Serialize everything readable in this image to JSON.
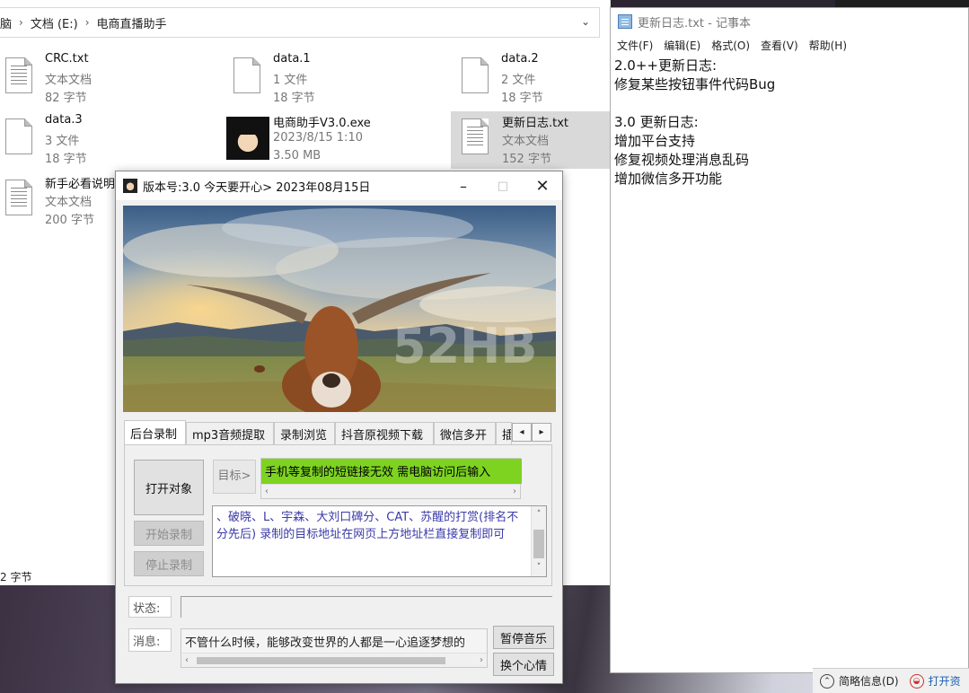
{
  "explorer": {
    "breadcrumb": [
      "脑",
      "文档 (E:)",
      "电商直播助手"
    ],
    "files": [
      {
        "name": "CRC.txt",
        "line2": "文本文档",
        "line3": "82 字节",
        "icon": "text-document-icon"
      },
      {
        "name": "data.1",
        "line2": "1 文件",
        "line3": "18 字节",
        "icon": "blank-document-icon"
      },
      {
        "name": "data.2",
        "line2": "2 文件",
        "line3": "18 字节",
        "icon": "blank-document-icon"
      },
      {
        "name": "data.3",
        "line2": "3 文件",
        "line3": "18 字节",
        "icon": "blank-document-icon"
      },
      {
        "name": "电商助手V3.0.exe",
        "line2": "2023/8/15 1:10",
        "line3": "3.50 MB",
        "icon": "exe-avatar-icon"
      },
      {
        "name": "更新日志.txt",
        "line2": "文本文档",
        "line3": "152 字节",
        "icon": "text-document-icon"
      },
      {
        "name": "新手必看说明",
        "line2": "文本文档",
        "line3": "200 字节",
        "icon": "text-document-icon"
      }
    ],
    "status_size": "2 字节"
  },
  "notepad": {
    "title": "更新日志.txt - 记事本",
    "menu": [
      "文件(F)",
      "编辑(E)",
      "格式(O)",
      "查看(V)",
      "帮助(H)"
    ],
    "lines": [
      "2.0++更新日志:",
      "修复某些按钮事件代码Bug",
      "",
      "3.0 更新日志:",
      "增加平台支持",
      "修复视频处理消息乱码",
      "增加微信多开功能"
    ]
  },
  "taskbar": {
    "brief_info": "简略信息(D)",
    "open_label": "打开资"
  },
  "app": {
    "title": "版本号:3.0 今天要开心> 2023年08月15日",
    "watermark": "52HB",
    "tabs": [
      "后台录制",
      "mp3音频提取",
      "录制浏览",
      "抖音原视频下载",
      "微信多开",
      "插"
    ],
    "open_target": "打开对象",
    "start_record": "开始录制",
    "stop_record": "停止录制",
    "target_label": "目标>",
    "target_hint": "手机等复制的短链接无效 需电脑访问后输入",
    "credits": "、破晓、L、宇森、大刘口碑分、CAT、苏醒的打赏(排名不分先后) 录制的目标地址在网页上方地址栏直接复制即可",
    "status_label": "状态:",
    "status_value": "",
    "message_label": "消息:",
    "message_text": "不管什么时候，能够改变世界的人都是一心追逐梦想的",
    "pause_music": "暂停音乐",
    "change_mood": "换个心情"
  }
}
